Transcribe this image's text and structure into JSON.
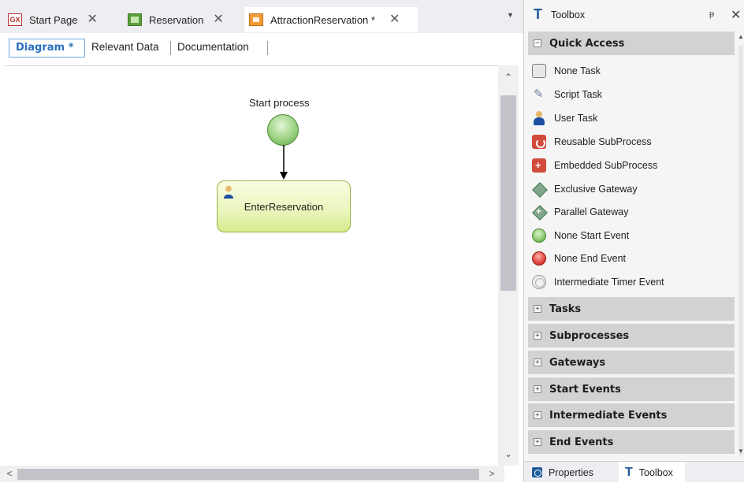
{
  "editor": {
    "tabs": [
      {
        "label": "Start Page",
        "icon": "gx-icon",
        "close": "✕"
      },
      {
        "label": "Reservation",
        "icon": "transaction-icon",
        "close": "✕"
      },
      {
        "label": "AttractionReservation *",
        "icon": "workflow-diagram-icon",
        "close": "✕"
      }
    ],
    "tab_dropdown": "▼",
    "subtabs": {
      "diagram": "Diagram *",
      "relevant_data": "Relevant Data",
      "documentation": "Documentation"
    },
    "diagram": {
      "start_event_label": "Start process",
      "task_label": "EnterReservation"
    },
    "scroll": {
      "up": "⌃",
      "down": "⌄",
      "left": "<",
      "right": ">"
    }
  },
  "toolbox": {
    "title": "Toolbox",
    "pin": "ᵽ",
    "close": "✕",
    "quick_access": {
      "label": "Quick Access",
      "sign": "−",
      "items": [
        {
          "label": "None Task",
          "icon": "none-task-icon"
        },
        {
          "label": "Script Task",
          "icon": "script-task-icon"
        },
        {
          "label": "User Task",
          "icon": "user-task-icon"
        },
        {
          "label": "Reusable SubProcess",
          "icon": "reusable-subprocess-icon"
        },
        {
          "label": "Embedded SubProcess",
          "icon": "embedded-subprocess-icon"
        },
        {
          "label": "Exclusive Gateway",
          "icon": "exclusive-gateway-icon"
        },
        {
          "label": "Parallel Gateway",
          "icon": "parallel-gateway-icon"
        },
        {
          "label": "None Start Event",
          "icon": "start-event-icon"
        },
        {
          "label": "None End Event",
          "icon": "end-event-icon"
        },
        {
          "label": "Intermediate Timer Event",
          "icon": "timer-event-icon"
        }
      ]
    },
    "categories": [
      {
        "label": "Tasks",
        "sign": "+"
      },
      {
        "label": "Subprocesses",
        "sign": "+"
      },
      {
        "label": "Gateways",
        "sign": "+"
      },
      {
        "label": "Start Events",
        "sign": "+"
      },
      {
        "label": "Intermediate Events",
        "sign": "+"
      },
      {
        "label": "End Events",
        "sign": "+"
      }
    ],
    "bottom_tabs": {
      "properties": "Properties",
      "toolbox": "Toolbox"
    }
  },
  "colors": {
    "accent": "#2a6fbf",
    "task_fill": "#eaf5bb",
    "start_event": "#8fcc72",
    "end_event": "#e0433a",
    "category_header": "#d2d2d2"
  }
}
